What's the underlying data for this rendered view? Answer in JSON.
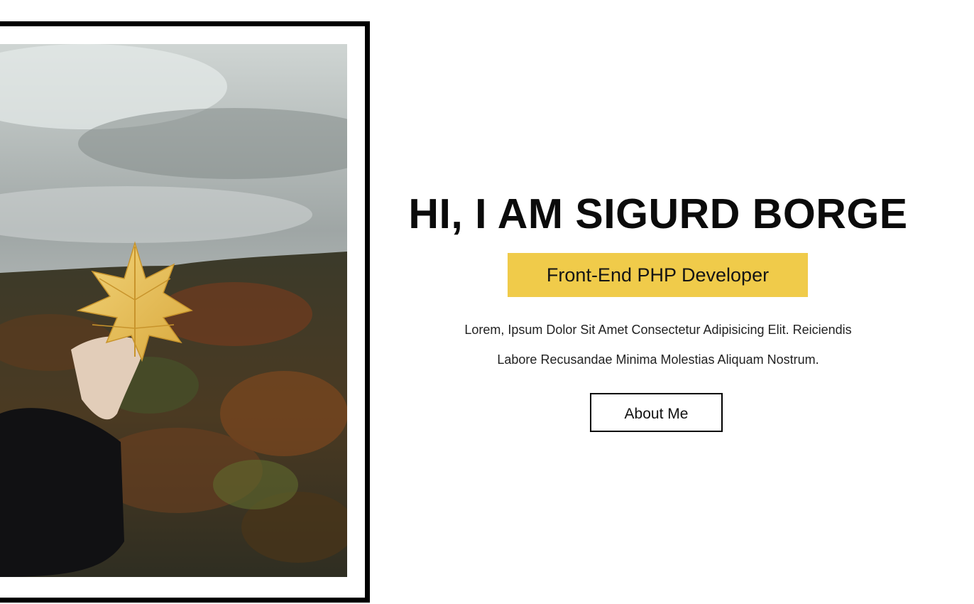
{
  "hero": {
    "title": "HI, I AM SIGURD BORGE",
    "role": "Front-End PHP Developer",
    "intro_line_1": "Lorem, Ipsum Dolor Sit Amet Consectetur Adipisicing Elit. Reiciendis",
    "intro_line_2": "Labore Recusandae Minima Molestias Aliquam Nostrum.",
    "about_button_label": "About Me"
  },
  "photo": {
    "subject": "hand-holding-maple-leaf-over-autumn-forest"
  },
  "colors": {
    "accent": "#f0cb4a",
    "frame": "#000000",
    "text": "#111111",
    "background": "#ffffff"
  }
}
